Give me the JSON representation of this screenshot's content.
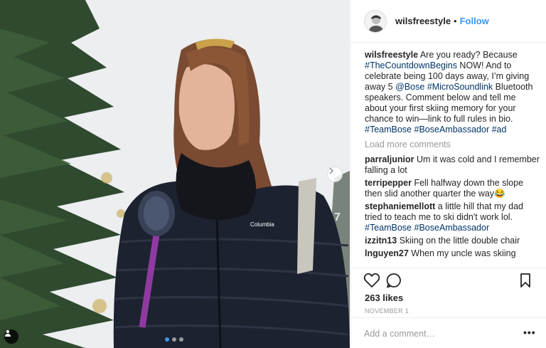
{
  "post": {
    "username": "wilsfreestyle",
    "separator": "•",
    "follow_label": "Follow",
    "caption": {
      "username": "wilsfreestyle",
      "t1": " Are you ready? Because ",
      "h1": "#TheCountdownBegins",
      "t2": " NOW! And to celebrate being 100 days away, I’m giving away 5 ",
      "h2": "@Bose",
      "t3": " ",
      "h3": "#MicroSoundlink",
      "t4": " Bluetooth speakers. Comment below and tell me about your first skiing memory for your chance to win—link to full rules in bio. ",
      "h4": "#TeamBose",
      "t5": " ",
      "h5": "#BoseAmbassador",
      "t6": " ",
      "h6": "#ad"
    },
    "load_more_label": "Load more comments",
    "comments": [
      {
        "user": "parraljunior",
        "text": " Um it was cold and I remember falling a lot"
      },
      {
        "user": "terripepper",
        "text": " Fell halfway down the slope then slid another quarter the way",
        "emoji": "😂"
      },
      {
        "user": "stephaniemellott",
        "text": " a little hill that my dad tried to teach me to ski didn't work lol. ",
        "tag1": "#TeamBose",
        "tag2": "#BoseAmbassador"
      },
      {
        "user": "izzitn13",
        "text": " Skiing on the little double chair"
      },
      {
        "user": "lnguyen27",
        "text": " When my uncle was skiing"
      }
    ],
    "likes": "263 likes",
    "date": "NOVEMBER 1",
    "add_comment_placeholder": "Add a comment…",
    "more_label": "•••",
    "carousel": {
      "total": 3,
      "active_index": 0
    },
    "photo_brand_text": "Columbia"
  },
  "icons": {
    "like": "heart-outline-icon",
    "comment": "speech-bubble-icon",
    "save": "bookmark-icon",
    "next": "chevron-right-icon",
    "user_tags": "user-silhouette-icon"
  },
  "colors": {
    "link": "#3897f0",
    "hashtag": "#003569",
    "muted": "#999999",
    "text": "#262626"
  }
}
